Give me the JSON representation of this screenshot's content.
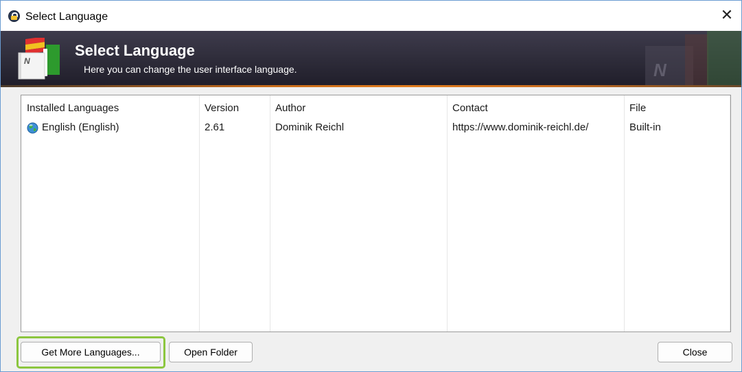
{
  "window": {
    "title": "Select Language",
    "close_glyph": "✕"
  },
  "banner": {
    "title": "Select Language",
    "subtitle": "Here you can change the user interface language."
  },
  "list": {
    "columns": [
      "Installed Languages",
      "Version",
      "Author",
      "Contact",
      "File"
    ],
    "rows": [
      {
        "language": "English (English)",
        "version": "2.61",
        "author": "Dominik Reichl",
        "contact": "https://www.dominik-reichl.de/",
        "file": "Built-in"
      }
    ]
  },
  "buttons": {
    "get_more": "Get More Languages...",
    "open_folder": "Open Folder",
    "close": "Close"
  },
  "icons": {
    "app": "keepass-lock-icon",
    "banner": "language-flag-book-icon",
    "row": "globe-icon"
  },
  "colors": {
    "banner_bg": "#302e3c",
    "accent_strip": "#e07b1c",
    "highlight": "#8cc63f",
    "window_border": "#6a9bd1"
  }
}
